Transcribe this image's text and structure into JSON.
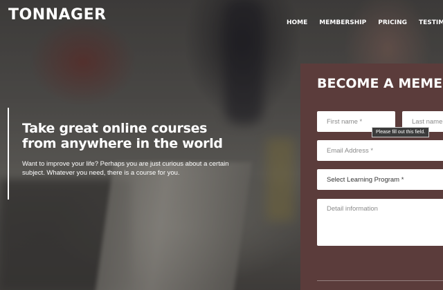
{
  "brand": {
    "name": "TONNAGER"
  },
  "nav": [
    "HOME",
    "MEMBERSHIP",
    "PRICING",
    "TESTIMONI"
  ],
  "hero": {
    "title": "Take great online courses from anywhere in the world",
    "subtitle": "Want to improve your life? Perhaps you are just curious about a certain subject. Whatever you need, there is a course for you."
  },
  "form": {
    "title": "BECOME A MEME",
    "first_name_placeholder": "First name *",
    "last_name_placeholder": "Last name",
    "email_placeholder": "Email Address *",
    "program_selected": "Select Learning Program *",
    "detail_placeholder": "Detail information",
    "tooltip": "Please fill out this field."
  },
  "colors": {
    "panel": "#5b3c3b",
    "text": "#ffffff"
  }
}
